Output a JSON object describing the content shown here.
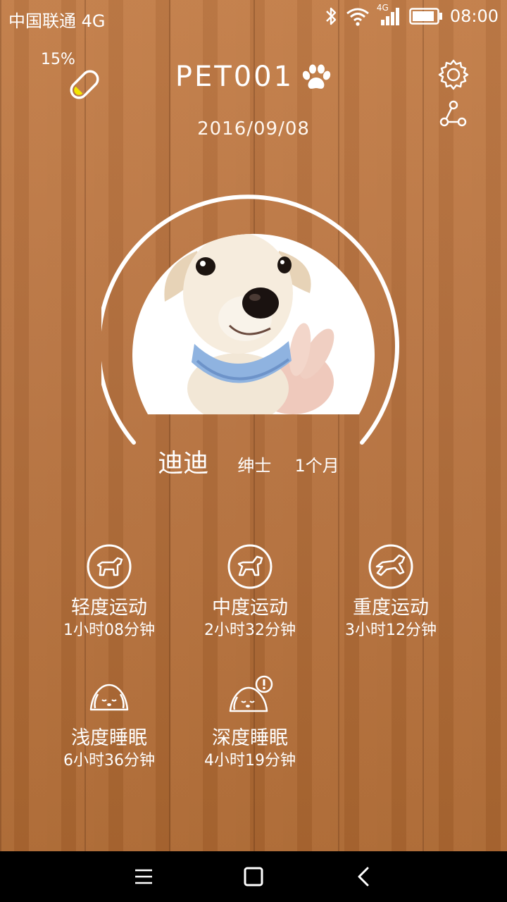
{
  "status_bar": {
    "carrier": "中国联通 4G",
    "network": "4G",
    "time": "08:00",
    "icons": [
      "bluetooth-icon",
      "wifi-icon",
      "signal-icon",
      "battery-icon"
    ]
  },
  "device": {
    "battery_percent": "15%",
    "battery_level": 0.15,
    "id": "PET001",
    "date": "2016/09/08"
  },
  "pet": {
    "name": "迪迪",
    "gender": "绅士",
    "age": "1个月"
  },
  "activity": [
    {
      "label": "轻度运动",
      "value": "1小时08分钟",
      "icon": "dog-walk-icon"
    },
    {
      "label": "中度运动",
      "value": "2小时32分钟",
      "icon": "dog-run-icon"
    },
    {
      "label": "重度运动",
      "value": "3小时12分钟",
      "icon": "dog-sprint-icon"
    }
  ],
  "sleep": [
    {
      "label": "浅度睡眠",
      "value": "6小时36分钟",
      "icon": "sleeping-dog-icon"
    },
    {
      "label": "深度睡眠",
      "value": "4小时19分钟",
      "icon": "sleeping-dog-alert-icon"
    }
  ],
  "colors": {
    "wood": "#b06a35",
    "battery_fill": "#f2e600",
    "text": "#ffffff",
    "nav_bar": "#000000"
  }
}
